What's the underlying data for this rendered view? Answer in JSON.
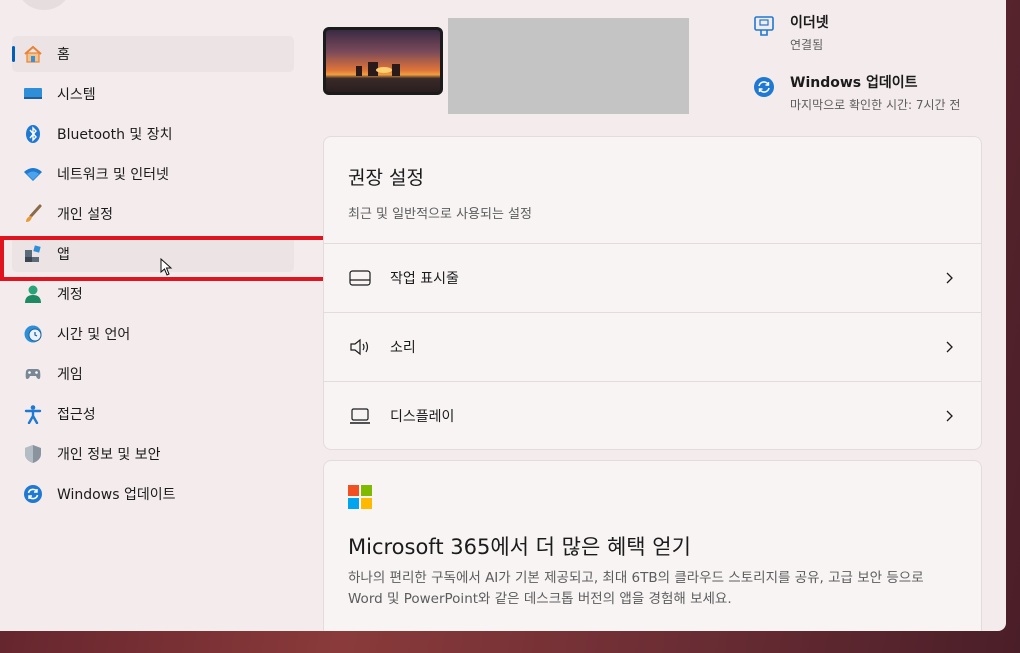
{
  "sidebar": {
    "items": [
      {
        "label": "홈",
        "icon": "home-icon"
      },
      {
        "label": "시스템",
        "icon": "system-icon"
      },
      {
        "label": "Bluetooth 및 장치",
        "icon": "bluetooth-icon"
      },
      {
        "label": "네트워크 및 인터넷",
        "icon": "wifi-icon"
      },
      {
        "label": "개인 설정",
        "icon": "brush-icon"
      },
      {
        "label": "앱",
        "icon": "apps-icon"
      },
      {
        "label": "계정",
        "icon": "account-icon"
      },
      {
        "label": "시간 및 언어",
        "icon": "clock-globe-icon"
      },
      {
        "label": "게임",
        "icon": "gamepad-icon"
      },
      {
        "label": "접근성",
        "icon": "accessibility-icon"
      },
      {
        "label": "개인 정보 및 보안",
        "icon": "shield-icon"
      },
      {
        "label": "Windows 업데이트",
        "icon": "update-icon"
      }
    ],
    "selected": "홈",
    "highlighted": "앱"
  },
  "status": {
    "ethernet": {
      "title": "이더넷",
      "subtitle": "연결됨"
    },
    "update": {
      "title": "Windows 업데이트",
      "subtitle": "마지막으로 확인한 시간: 7시간 전"
    }
  },
  "recommended": {
    "title": "권장 설정",
    "subtitle": "최근 및 일반적으로 사용되는 설정",
    "rows": [
      {
        "label": "작업 표시줄",
        "icon": "taskbar-icon"
      },
      {
        "label": "소리",
        "icon": "speaker-icon"
      },
      {
        "label": "디스플레이",
        "icon": "display-icon"
      }
    ]
  },
  "m365": {
    "title": "Microsoft 365에서 더 많은 혜택 얻기",
    "body": "하나의 편리한 구독에서 AI가 기본 제공되고, 최대 6TB의 클라우드 스토리지를 공유, 고급 보안 등으로 Word 및 PowerPoint와 같은 데스크톱 버전의 앱을 경험해 보세요."
  },
  "colors": {
    "accent": "#005fb8",
    "highlight": "#e0141e"
  }
}
